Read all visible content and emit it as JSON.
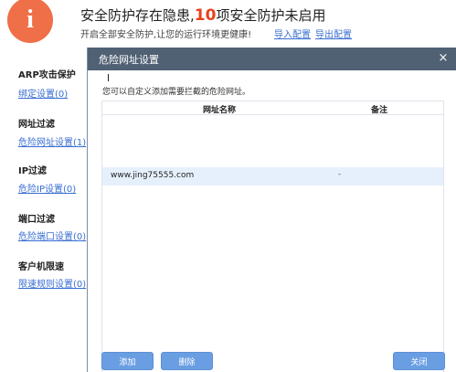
{
  "page": {
    "headline_pre": "安全防护存在隐患,",
    "headline_num": "10",
    "headline_post": "项安全防护未启用",
    "subline": "开启全部安全防护,让您的运行环境更健康!",
    "import_link": "导入配置",
    "export_link": "导出配置"
  },
  "sections": [
    {
      "title": "ARP攻击保护",
      "link": "绑定设置(0)"
    },
    {
      "title": "网址过滤",
      "link": "危险网址设置(1)"
    },
    {
      "title": "IP过滤",
      "link": "危险IP设置(0)"
    },
    {
      "title": "端口过滤",
      "link": "危险端口设置(0)"
    },
    {
      "title": "客户机限速",
      "link": "限速规则设置(0)"
    }
  ],
  "dialog": {
    "title": "危险网址设置",
    "close_glyph": "×",
    "description": "您可以自定义添加需要拦截的危险网址。",
    "columns": [
      "网址名称",
      "备注"
    ],
    "rows": [
      {
        "url": "www.jing75555.com",
        "note": "-"
      }
    ],
    "add_label": "添加",
    "delete_label": "删除",
    "close_label": "关闭"
  },
  "colors": {
    "warning": "#ef6f48",
    "titlebar": "#516174",
    "button": "#6a9ee3",
    "link": "#3a6fd1"
  }
}
